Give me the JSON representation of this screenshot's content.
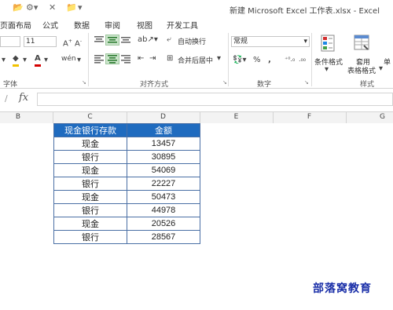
{
  "window": {
    "title": "新建 Microsoft Excel 工作表.xlsx - Excel"
  },
  "tabs": [
    "页面布局",
    "公式",
    "数据",
    "审阅",
    "视图",
    "开发工具"
  ],
  "ribbon": {
    "font_size": "11",
    "wrap_text": "自动换行",
    "merge_center": "合并后居中",
    "number_format": "常规",
    "cond_format": "条件格式",
    "table_format_line1": "套用",
    "table_format_line2": "表格格式",
    "cell_styles_partial": "单",
    "groups": {
      "font": "字体",
      "alignment": "对齐方式",
      "number": "数字",
      "styles": "样式"
    }
  },
  "formula_bar": {
    "fx": "fx",
    "value": ""
  },
  "columns": [
    "B",
    "C",
    "D",
    "E",
    "F",
    "G"
  ],
  "table": {
    "headers": [
      "现金银行存款",
      "金额"
    ],
    "rows": [
      [
        "现金",
        "13457"
      ],
      [
        "银行",
        "30895"
      ],
      [
        "现金",
        "54069"
      ],
      [
        "银行",
        "22227"
      ],
      [
        "现金",
        "50473"
      ],
      [
        "银行",
        "44978"
      ],
      [
        "现金",
        "20526"
      ],
      [
        "银行",
        "28567"
      ]
    ]
  },
  "watermark": "部落窝教育",
  "colors": {
    "header_fill": "#1f6bbf",
    "header_text": "#ffffff",
    "watermark": "#1a2fa8"
  }
}
